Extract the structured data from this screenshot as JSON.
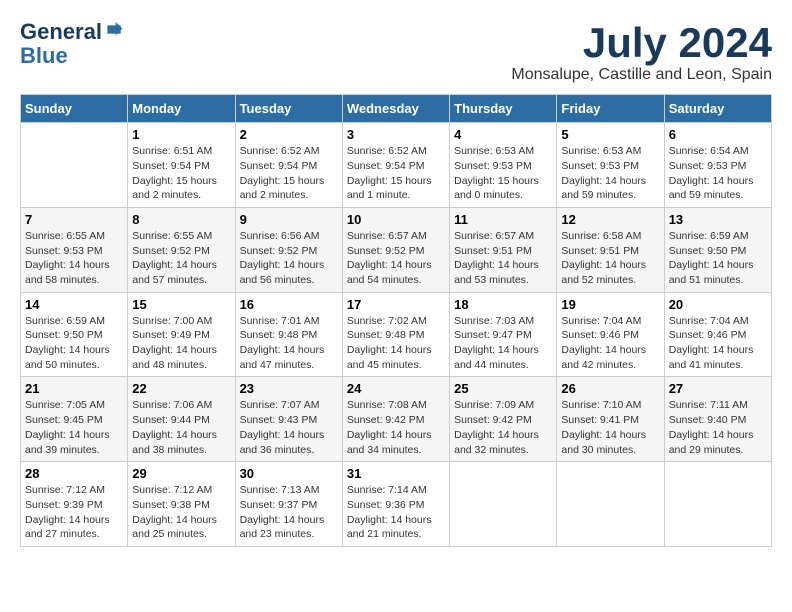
{
  "header": {
    "logo_line1": "General",
    "logo_line2": "Blue",
    "month": "July 2024",
    "location": "Monsalupe, Castille and Leon, Spain"
  },
  "weekdays": [
    "Sunday",
    "Monday",
    "Tuesday",
    "Wednesday",
    "Thursday",
    "Friday",
    "Saturday"
  ],
  "weeks": [
    [
      {
        "day": "",
        "info": ""
      },
      {
        "day": "1",
        "info": "Sunrise: 6:51 AM\nSunset: 9:54 PM\nDaylight: 15 hours\nand 2 minutes."
      },
      {
        "day": "2",
        "info": "Sunrise: 6:52 AM\nSunset: 9:54 PM\nDaylight: 15 hours\nand 2 minutes."
      },
      {
        "day": "3",
        "info": "Sunrise: 6:52 AM\nSunset: 9:54 PM\nDaylight: 15 hours\nand 1 minute."
      },
      {
        "day": "4",
        "info": "Sunrise: 6:53 AM\nSunset: 9:53 PM\nDaylight: 15 hours\nand 0 minutes."
      },
      {
        "day": "5",
        "info": "Sunrise: 6:53 AM\nSunset: 9:53 PM\nDaylight: 14 hours\nand 59 minutes."
      },
      {
        "day": "6",
        "info": "Sunrise: 6:54 AM\nSunset: 9:53 PM\nDaylight: 14 hours\nand 59 minutes."
      }
    ],
    [
      {
        "day": "7",
        "info": "Sunrise: 6:55 AM\nSunset: 9:53 PM\nDaylight: 14 hours\nand 58 minutes."
      },
      {
        "day": "8",
        "info": "Sunrise: 6:55 AM\nSunset: 9:52 PM\nDaylight: 14 hours\nand 57 minutes."
      },
      {
        "day": "9",
        "info": "Sunrise: 6:56 AM\nSunset: 9:52 PM\nDaylight: 14 hours\nand 56 minutes."
      },
      {
        "day": "10",
        "info": "Sunrise: 6:57 AM\nSunset: 9:52 PM\nDaylight: 14 hours\nand 54 minutes."
      },
      {
        "day": "11",
        "info": "Sunrise: 6:57 AM\nSunset: 9:51 PM\nDaylight: 14 hours\nand 53 minutes."
      },
      {
        "day": "12",
        "info": "Sunrise: 6:58 AM\nSunset: 9:51 PM\nDaylight: 14 hours\nand 52 minutes."
      },
      {
        "day": "13",
        "info": "Sunrise: 6:59 AM\nSunset: 9:50 PM\nDaylight: 14 hours\nand 51 minutes."
      }
    ],
    [
      {
        "day": "14",
        "info": "Sunrise: 6:59 AM\nSunset: 9:50 PM\nDaylight: 14 hours\nand 50 minutes."
      },
      {
        "day": "15",
        "info": "Sunrise: 7:00 AM\nSunset: 9:49 PM\nDaylight: 14 hours\nand 48 minutes."
      },
      {
        "day": "16",
        "info": "Sunrise: 7:01 AM\nSunset: 9:48 PM\nDaylight: 14 hours\nand 47 minutes."
      },
      {
        "day": "17",
        "info": "Sunrise: 7:02 AM\nSunset: 9:48 PM\nDaylight: 14 hours\nand 45 minutes."
      },
      {
        "day": "18",
        "info": "Sunrise: 7:03 AM\nSunset: 9:47 PM\nDaylight: 14 hours\nand 44 minutes."
      },
      {
        "day": "19",
        "info": "Sunrise: 7:04 AM\nSunset: 9:46 PM\nDaylight: 14 hours\nand 42 minutes."
      },
      {
        "day": "20",
        "info": "Sunrise: 7:04 AM\nSunset: 9:46 PM\nDaylight: 14 hours\nand 41 minutes."
      }
    ],
    [
      {
        "day": "21",
        "info": "Sunrise: 7:05 AM\nSunset: 9:45 PM\nDaylight: 14 hours\nand 39 minutes."
      },
      {
        "day": "22",
        "info": "Sunrise: 7:06 AM\nSunset: 9:44 PM\nDaylight: 14 hours\nand 38 minutes."
      },
      {
        "day": "23",
        "info": "Sunrise: 7:07 AM\nSunset: 9:43 PM\nDaylight: 14 hours\nand 36 minutes."
      },
      {
        "day": "24",
        "info": "Sunrise: 7:08 AM\nSunset: 9:42 PM\nDaylight: 14 hours\nand 34 minutes."
      },
      {
        "day": "25",
        "info": "Sunrise: 7:09 AM\nSunset: 9:42 PM\nDaylight: 14 hours\nand 32 minutes."
      },
      {
        "day": "26",
        "info": "Sunrise: 7:10 AM\nSunset: 9:41 PM\nDaylight: 14 hours\nand 30 minutes."
      },
      {
        "day": "27",
        "info": "Sunrise: 7:11 AM\nSunset: 9:40 PM\nDaylight: 14 hours\nand 29 minutes."
      }
    ],
    [
      {
        "day": "28",
        "info": "Sunrise: 7:12 AM\nSunset: 9:39 PM\nDaylight: 14 hours\nand 27 minutes."
      },
      {
        "day": "29",
        "info": "Sunrise: 7:12 AM\nSunset: 9:38 PM\nDaylight: 14 hours\nand 25 minutes."
      },
      {
        "day": "30",
        "info": "Sunrise: 7:13 AM\nSunset: 9:37 PM\nDaylight: 14 hours\nand 23 minutes."
      },
      {
        "day": "31",
        "info": "Sunrise: 7:14 AM\nSunset: 9:36 PM\nDaylight: 14 hours\nand 21 minutes."
      },
      {
        "day": "",
        "info": ""
      },
      {
        "day": "",
        "info": ""
      },
      {
        "day": "",
        "info": ""
      }
    ]
  ]
}
